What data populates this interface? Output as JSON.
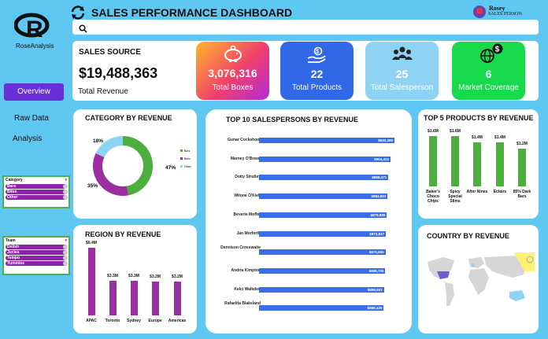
{
  "brand": {
    "name": "RoseAnalysis"
  },
  "header": {
    "title": "SALES PERFORMANCE DASHBOARD",
    "user_name": "Rosey",
    "user_role": "SALES PERSON"
  },
  "sidebar": {
    "items": [
      {
        "label": "Overview"
      },
      {
        "label": "Raw Data"
      },
      {
        "label": "Analysis"
      }
    ]
  },
  "slicers": [
    {
      "title": "Category",
      "items": [
        "Bars",
        "Bites",
        "Other"
      ]
    },
    {
      "title": "Team",
      "items": [
        "Delish",
        "Jucies",
        "Tempo",
        "Yummies"
      ]
    }
  ],
  "sales_source": {
    "label": "SALES SOURCE",
    "value": "$19,488,363",
    "sub": "Total Revenue"
  },
  "kpis": [
    {
      "value": "3,076,316",
      "label": "Total Boxes",
      "icon": "piggy-bank-icon"
    },
    {
      "value": "22",
      "label": "Total Products",
      "icon": "money-hand-icon"
    },
    {
      "value": "25",
      "label": "Total Salesperson",
      "icon": "people-icon"
    },
    {
      "value": "6",
      "label": "Market Coverage",
      "icon": "globe-dollar-icon"
    }
  ],
  "colors": {
    "background": "#5ec8f2",
    "bars_blue": "#3a6ee8",
    "bars_purple": "#9b2fa0",
    "bars_green": "#4cae3c"
  },
  "country_title": "COUNTRY BY REVENUE",
  "chart_data": [
    {
      "type": "pie",
      "title": "CATEGORY BY REVENUE",
      "categories": [
        "Bars",
        "Bites",
        "Other"
      ],
      "values": [
        47,
        35,
        18
      ],
      "labels": [
        "47%",
        "35%",
        "18%"
      ],
      "colors": [
        "#4cae3c",
        "#9b2fa0",
        "#8fd3f4"
      ]
    },
    {
      "type": "bar",
      "title": "TOP 10 SALESPERSONS BY REVENUE",
      "categories": [
        "Gunar Cockshoot",
        "Marney O'Breen",
        "Dotty Strutley",
        "Wilone O'Kielt",
        "Beverie Moffet",
        "Jan Morforth",
        "Dennison Crosswaite",
        "Andria Kimpton",
        "Kelci Walkden",
        "Rafaelita Blaksland"
      ],
      "values": [
        932286,
        904422,
        889471,
        884833,
        879989,
        872817,
        870955,
        869700,
        859591,
        858425
      ],
      "labels": [
        "$932,286",
        "$904,422",
        "$889,471",
        "$884,833",
        "$879,989",
        "$872,817",
        "$870,955",
        "$869,700",
        "$859,591",
        "$858,425"
      ]
    },
    {
      "type": "bar",
      "title": "REGION BY REVENUE",
      "categories": [
        "APAC",
        "Toronto",
        "Sydney",
        "Europe",
        "Americas"
      ],
      "values": [
        6.4,
        3.3,
        3.3,
        3.2,
        3.2
      ],
      "labels": [
        "$6.4M",
        "$3.3M",
        "$3.3M",
        "$3.2M",
        "$3.2M"
      ]
    },
    {
      "type": "bar",
      "title": "TOP 5 PRODUCTS BY REVENUE",
      "categories": [
        "Baker's Choco Chips",
        "Spicy Special Slims",
        "After Nines",
        "Eclairs",
        "85% Dark Bars"
      ],
      "values": [
        1.6,
        1.6,
        1.4,
        1.4,
        1.2
      ],
      "labels": [
        "$1.6M",
        "$1.6M",
        "$1.4M",
        "$1.4M",
        "$1.2M"
      ]
    }
  ]
}
